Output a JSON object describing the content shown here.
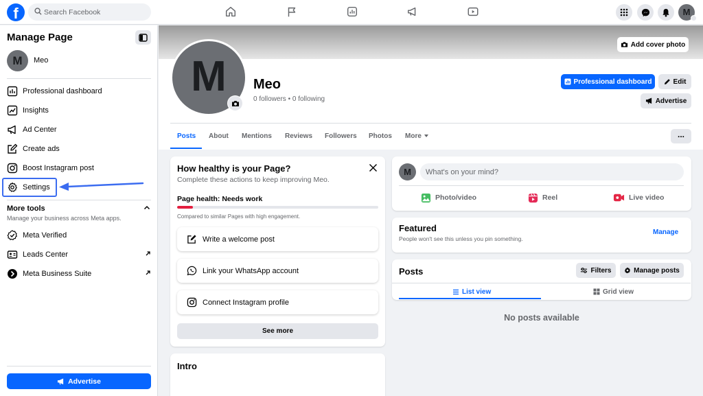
{
  "topbar": {
    "logo_letter": "f",
    "search_placeholder": "Search Facebook",
    "profile_initial": "M"
  },
  "sidebar": {
    "title": "Manage Page",
    "page_initial": "M",
    "page_name": "Meo",
    "items": [
      {
        "label": "Professional dashboard",
        "icon": "dashboard-icon"
      },
      {
        "label": "Insights",
        "icon": "insights-icon"
      },
      {
        "label": "Ad Center",
        "icon": "megaphone-icon"
      },
      {
        "label": "Create ads",
        "icon": "pencil-square-icon"
      },
      {
        "label": "Boost Instagram post",
        "icon": "instagram-icon"
      },
      {
        "label": "Settings",
        "icon": "gear-icon"
      }
    ],
    "more_tools": {
      "title": "More tools",
      "subtitle": "Manage your business across Meta apps.",
      "items": [
        {
          "label": "Meta Verified",
          "icon": "verified-badge-icon"
        },
        {
          "label": "Leads Center",
          "icon": "contact-card-icon"
        },
        {
          "label": "Meta Business Suite",
          "icon": "meta-suite-icon"
        }
      ]
    },
    "advertise_label": "Advertise"
  },
  "header": {
    "add_cover_label": "Add cover photo",
    "avatar_initial": "M",
    "page_name": "Meo",
    "follow_stats": "0 followers • 0 following",
    "pro_dashboard_label": "Professional dashboard",
    "edit_label": "Edit",
    "advertise_label": "Advertise",
    "tabs": [
      "Posts",
      "About",
      "Mentions",
      "Reviews",
      "Followers",
      "Photos",
      "More"
    ],
    "active_tab": "Posts",
    "more_menu_label": "..."
  },
  "health_card": {
    "title": "How healthy is your Page?",
    "subtitle_prefix": "Complete these actions to keep improving ",
    "subtitle_page": "Meo",
    "subtitle_suffix": ".",
    "health_label": "Page health: Needs work",
    "health_progress": 0.08,
    "comparison": "Compared to similar Pages with high engagement.",
    "tasks": [
      {
        "label": "Write a welcome post",
        "icon": "compose-icon"
      },
      {
        "label": "Link your WhatsApp account",
        "icon": "whatsapp-icon"
      },
      {
        "label": "Connect Instagram profile",
        "icon": "instagram-icon"
      }
    ],
    "see_more_label": "See more"
  },
  "intro_card": {
    "title": "Intro"
  },
  "composer": {
    "avatar_initial": "M",
    "placeholder": "What's on your mind?",
    "actions": [
      {
        "label": "Photo/video",
        "icon": "photo-icon"
      },
      {
        "label": "Reel",
        "icon": "reel-icon"
      },
      {
        "label": "Live video",
        "icon": "live-video-icon"
      }
    ]
  },
  "featured": {
    "title": "Featured",
    "subtitle": "People won't see this unless you pin something.",
    "manage_label": "Manage"
  },
  "posts": {
    "title": "Posts",
    "filters_label": "Filters",
    "manage_label": "Manage posts",
    "list_view_label": "List view",
    "grid_view_label": "Grid view",
    "empty_text": "No posts available"
  },
  "colors": {
    "brand_blue": "#0866ff",
    "highlight_blue": "#3b6cf0",
    "health_red": "#e41e3f"
  }
}
